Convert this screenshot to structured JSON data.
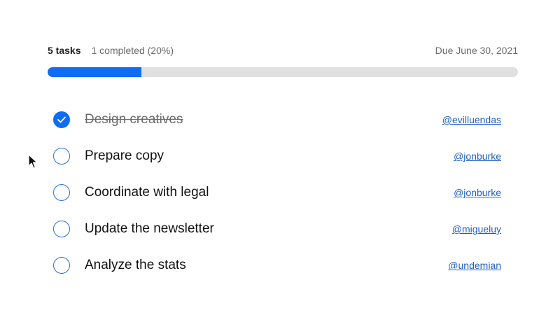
{
  "summary": {
    "task_count": "5 tasks",
    "completed_text": "1 completed (20%)",
    "due_date": "Due June 30, 2021",
    "progress_fraction": 0.2
  },
  "colors": {
    "accent": "#0f6cf5",
    "track": "#e0e0e0",
    "link": "#1f5fbf"
  },
  "tasks": [
    {
      "title": "Design creatives",
      "assignee": "@evilluendas",
      "completed": true
    },
    {
      "title": "Prepare copy",
      "assignee": "@jonburke",
      "completed": false
    },
    {
      "title": "Coordinate with legal",
      "assignee": "@jonburke",
      "completed": false
    },
    {
      "title": "Update the newsletter",
      "assignee": "@migueluy",
      "completed": false
    },
    {
      "title": "Analyze the stats",
      "assignee": "@undemian",
      "completed": false
    }
  ],
  "icons": {
    "checkbox_checked": "check-icon",
    "cursor": "mouse-pointer-icon"
  }
}
